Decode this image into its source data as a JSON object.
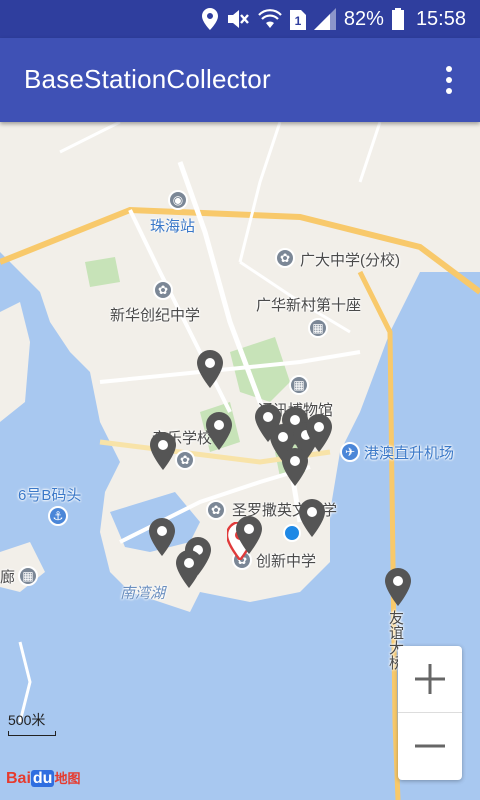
{
  "status": {
    "battery": "82%",
    "time": "15:58"
  },
  "app": {
    "title": "BaseStationCollector"
  },
  "map": {
    "labels": {
      "zhuhai_station": "珠海站",
      "guangda": "广大中学(分校)",
      "xinhua": "新华创纪中学",
      "guanghua": "广华新村第十座",
      "museum": "通讯博物馆",
      "music": "音乐学校",
      "heli": "港澳直升机场",
      "pier": "6号B码头",
      "saint": "圣罗撒英文中学",
      "chuangxin": "创新中学",
      "nanwan": "南湾湖",
      "youyi": "友谊大桥",
      "lang": "廊"
    },
    "scale": "500米",
    "logo_text": "Bai",
    "logo_du": "du",
    "logo_suffix": "地图"
  },
  "colors": {
    "status_bar": "#2f3e9e",
    "app_bar": "#3f51b5",
    "water": "#a8c8f0",
    "land": "#f2efe9",
    "park": "#c7e3b8",
    "road_main": "#f8c96b",
    "marker": "#555555",
    "marker_selected": "#e03a3a",
    "location_dot": "#1e88e5"
  },
  "icons": [
    "location-icon",
    "mute-icon",
    "wifi-icon",
    "sim-icon",
    "signal-icon",
    "battery-icon",
    "overflow-menu-icon",
    "zoom-in-icon",
    "zoom-out-icon"
  ]
}
